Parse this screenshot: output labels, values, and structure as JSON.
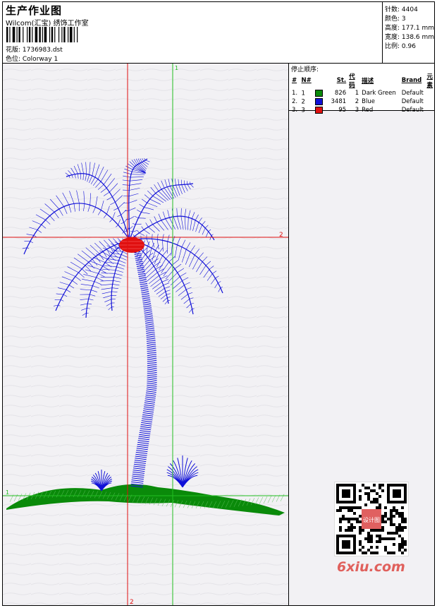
{
  "header": {
    "title": "生产作业图",
    "company": "Wilcom(汇宝) 绣饰工作室",
    "design_label": "花版: 1736983.dst",
    "color_label": "色位: Colorway 1"
  },
  "stats": {
    "stitches": "针数: 4404",
    "colors": "颜色: 3",
    "height": "高度: 177.1 mm",
    "width": "宽度: 138.6 mm",
    "scale": "比例: 0.96"
  },
  "stop_sequence": {
    "title": "停止顺序:",
    "headers": [
      "#",
      "N#",
      "St.",
      "代码",
      "描述",
      "Brand",
      "元素"
    ],
    "rows": [
      {
        "idx": "1.",
        "n": "1",
        "color": "#0a8a0a",
        "st": "826",
        "code": "1",
        "desc": "Dark Green",
        "brand": "Default"
      },
      {
        "idx": "2.",
        "n": "2",
        "color": "#1010d8",
        "st": "3481",
        "code": "2",
        "desc": "Blue",
        "brand": "Default"
      },
      {
        "idx": "3.",
        "n": "3",
        "color": "#e01010",
        "st": "95",
        "code": "3",
        "desc": "Red",
        "brand": "Default"
      }
    ]
  },
  "crosshair_labels": {
    "v1": "1",
    "h2": "2",
    "h1": "1",
    "v2": "2"
  },
  "watermark": {
    "logo_text": "6xiu.com",
    "qr_center_text": "设计图"
  },
  "colors": {
    "green": "#0a8a0a",
    "blue": "#1010d8",
    "red": "#e01010",
    "crosshair_red": "#e01010",
    "crosshair_green": "#21c021"
  }
}
